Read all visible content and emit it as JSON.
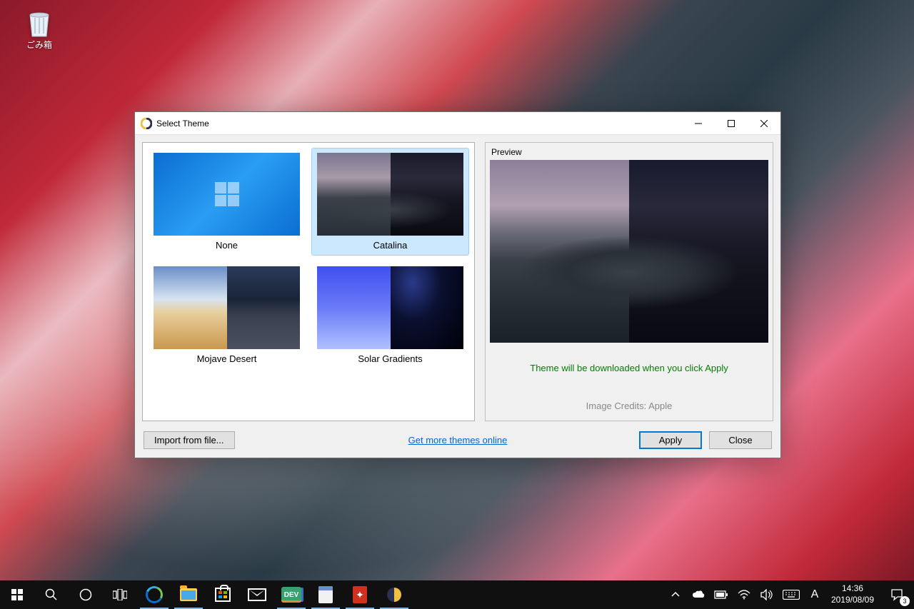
{
  "desktop": {
    "recycle_bin_label": "ごみ箱"
  },
  "window": {
    "title": "Select Theme",
    "themes": [
      {
        "label": "None"
      },
      {
        "label": "Catalina"
      },
      {
        "label": "Mojave Desert"
      },
      {
        "label": "Solar Gradients"
      }
    ],
    "preview_label": "Preview",
    "preview_status": "Theme will be downloaded when you click Apply",
    "preview_credits": "Image Credits: Apple",
    "import_button": "Import from file...",
    "more_themes_link": "Get more themes online",
    "apply_button": "Apply",
    "close_button": "Close"
  },
  "taskbar": {
    "clock_time": "14:36",
    "clock_date": "2019/08/09",
    "notif_count": "3",
    "ime_mode": "A",
    "dev_label": "DEV"
  }
}
